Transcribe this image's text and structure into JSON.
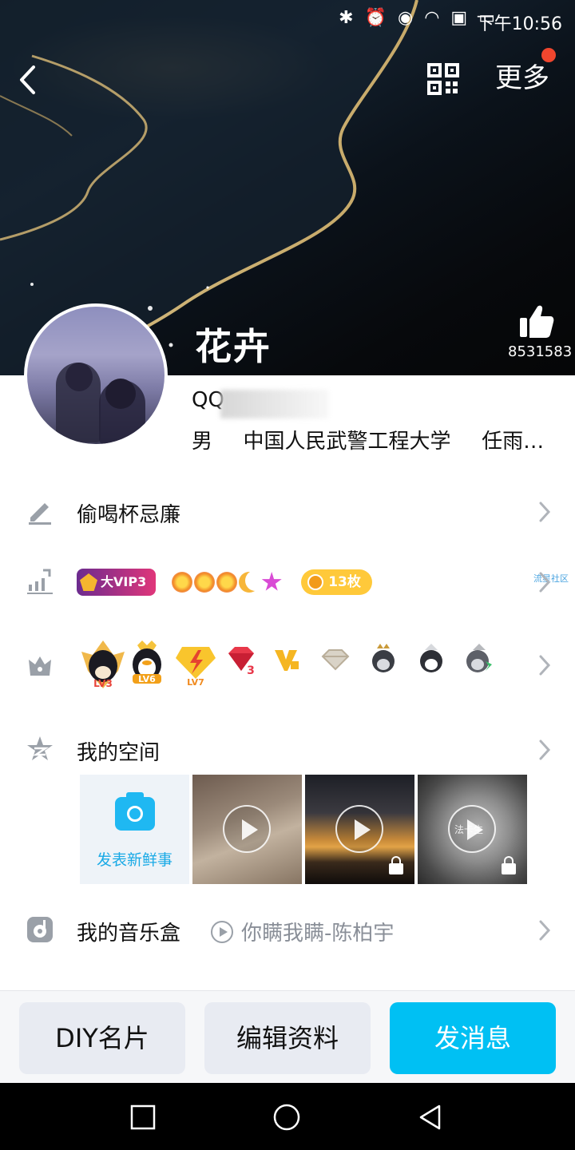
{
  "status_bar": {
    "time": "下午10:56",
    "icons": [
      "bluetooth-icon",
      "alarm-icon",
      "eye-icon",
      "wifi-icon",
      "alert-icon",
      "battery-charging-icon"
    ]
  },
  "header": {
    "back_icon": "chevron-left-icon",
    "qr_icon": "qr-code-icon",
    "more_label": "更多",
    "notification_dot_color": "#f0462e"
  },
  "profile": {
    "nickname": "花卉",
    "like_count": "8531583",
    "qq_prefix": "QQ",
    "gender": "男",
    "school": "中国人民武警工程大学",
    "extra": "任雨…"
  },
  "signature": {
    "text": "偷喝杯忌廉"
  },
  "level_row": {
    "vip_label": "大VIP3",
    "coin_label": "13枚",
    "community_label": "流星社区"
  },
  "honors_row": {
    "items": [
      "LV3",
      "LV6",
      "LV7",
      "3",
      "",
      "",
      "",
      "",
      ""
    ]
  },
  "space": {
    "title": "我的空间",
    "post_label": "发表新鲜事",
    "tile3_caption": "法卡生"
  },
  "music": {
    "title": "我的音乐盒",
    "song": "你瞒我瞒-陈柏宇"
  },
  "actions": {
    "diy": "DIY名片",
    "edit": "编辑资料",
    "message": "发消息"
  },
  "colors": {
    "accent": "#00c0f3",
    "secondary_button": "#e8ebf2",
    "link": "#1aaae6"
  }
}
